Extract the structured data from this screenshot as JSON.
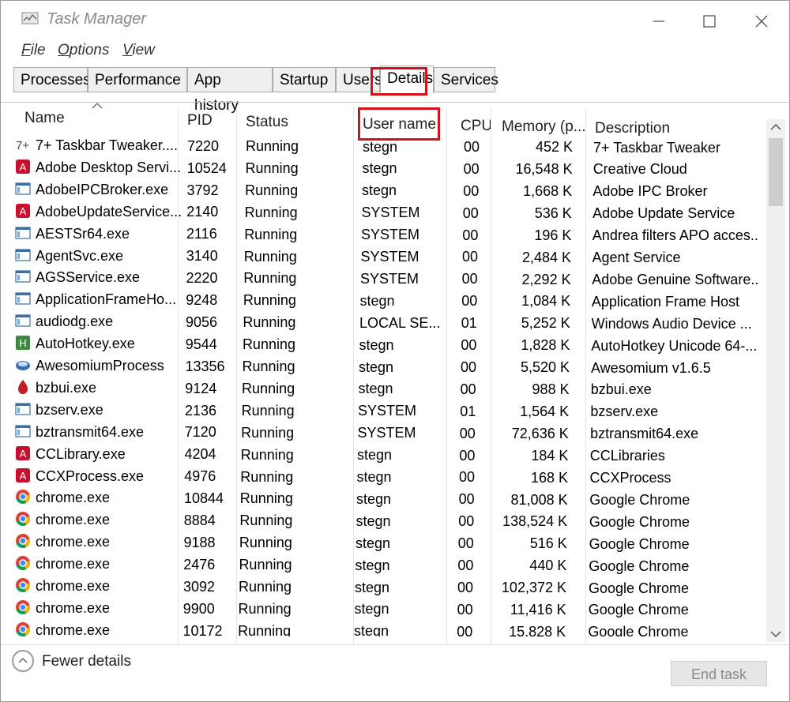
{
  "window": {
    "title": "Task Manager"
  },
  "menu": [
    {
      "label": "File",
      "underline": "F",
      "rest": "ile"
    },
    {
      "label": "Options",
      "underline": "O",
      "rest": "ptions"
    },
    {
      "label": "View",
      "underline": "V",
      "rest": "iew"
    }
  ],
  "tabs": [
    {
      "label": "Processes"
    },
    {
      "label": "Performance"
    },
    {
      "label": "App history"
    },
    {
      "label": "Startup"
    },
    {
      "label": "Users"
    },
    {
      "label": "Details",
      "active": true
    },
    {
      "label": "Services"
    }
  ],
  "columns": {
    "name": "Name",
    "pid": "PID",
    "status": "Status",
    "user": "User name",
    "cpu": "CPU",
    "memory": "Memory (p...",
    "description": "Description"
  },
  "rows": [
    {
      "icon": "taskbar-tweaker-icon",
      "name": "7+ Taskbar Tweaker....",
      "pid": "7220",
      "status": "Running",
      "user": "stegn",
      "cpu": "00",
      "memory": "452 K",
      "description": "7+ Taskbar Tweaker"
    },
    {
      "icon": "adobe-icon",
      "name": "Adobe Desktop Servi...",
      "pid": "10524",
      "status": "Running",
      "user": "stegn",
      "cpu": "00",
      "memory": "16,548 K",
      "description": "Creative Cloud"
    },
    {
      "icon": "app-window-icon",
      "name": "AdobeIPCBroker.exe",
      "pid": "3792",
      "status": "Running",
      "user": "stegn",
      "cpu": "00",
      "memory": "1,668 K",
      "description": "Adobe IPC Broker"
    },
    {
      "icon": "adobe-icon",
      "name": "AdobeUpdateService...",
      "pid": "2140",
      "status": "Running",
      "user": "SYSTEM",
      "cpu": "00",
      "memory": "536 K",
      "description": "Adobe Update Service"
    },
    {
      "icon": "app-window-icon",
      "name": "AESTSr64.exe",
      "pid": "2116",
      "status": "Running",
      "user": "SYSTEM",
      "cpu": "00",
      "memory": "196 K",
      "description": "Andrea filters APO acces..."
    },
    {
      "icon": "app-window-icon",
      "name": "AgentSvc.exe",
      "pid": "3140",
      "status": "Running",
      "user": "SYSTEM",
      "cpu": "00",
      "memory": "2,484 K",
      "description": "Agent Service"
    },
    {
      "icon": "app-window-icon",
      "name": "AGSService.exe",
      "pid": "2220",
      "status": "Running",
      "user": "SYSTEM",
      "cpu": "00",
      "memory": "2,292 K",
      "description": "Adobe Genuine Software..."
    },
    {
      "icon": "app-window-icon",
      "name": "ApplicationFrameHo...",
      "pid": "9248",
      "status": "Running",
      "user": "stegn",
      "cpu": "00",
      "memory": "1,084 K",
      "description": "Application Frame Host"
    },
    {
      "icon": "app-window-icon",
      "name": "audiodg.exe",
      "pid": "9056",
      "status": "Running",
      "user": "LOCAL SE...",
      "cpu": "01",
      "memory": "5,252 K",
      "description": "Windows Audio Device ..."
    },
    {
      "icon": "autohotkey-icon",
      "name": "AutoHotkey.exe",
      "pid": "9544",
      "status": "Running",
      "user": "stegn",
      "cpu": "00",
      "memory": "1,828 K",
      "description": "AutoHotkey Unicode 64-..."
    },
    {
      "icon": "awesomium-icon",
      "name": "AwesomiumProcess",
      "pid": "13356",
      "status": "Running",
      "user": "stegn",
      "cpu": "00",
      "memory": "5,520 K",
      "description": "Awesomium v1.6.5"
    },
    {
      "icon": "bzbui-icon",
      "name": "bzbui.exe",
      "pid": "9124",
      "status": "Running",
      "user": "stegn",
      "cpu": "00",
      "memory": "988 K",
      "description": "bzbui.exe"
    },
    {
      "icon": "app-window-icon",
      "name": "bzserv.exe",
      "pid": "2136",
      "status": "Running",
      "user": "SYSTEM",
      "cpu": "01",
      "memory": "1,564 K",
      "description": "bzserv.exe"
    },
    {
      "icon": "app-window-icon",
      "name": "bztransmit64.exe",
      "pid": "7120",
      "status": "Running",
      "user": "SYSTEM",
      "cpu": "00",
      "memory": "72,636 K",
      "description": "bztransmit64.exe"
    },
    {
      "icon": "adobe-icon",
      "name": "CCLibrary.exe",
      "pid": "4204",
      "status": "Running",
      "user": "stegn",
      "cpu": "00",
      "memory": "184 K",
      "description": "CCLibraries"
    },
    {
      "icon": "adobe-icon",
      "name": "CCXProcess.exe",
      "pid": "4976",
      "status": "Running",
      "user": "stegn",
      "cpu": "00",
      "memory": "168 K",
      "description": "CCXProcess"
    },
    {
      "icon": "chrome-icon",
      "name": "chrome.exe",
      "pid": "10844",
      "status": "Running",
      "user": "stegn",
      "cpu": "00",
      "memory": "81,008 K",
      "description": "Google Chrome"
    },
    {
      "icon": "chrome-icon",
      "name": "chrome.exe",
      "pid": "8884",
      "status": "Running",
      "user": "stegn",
      "cpu": "00",
      "memory": "138,524 K",
      "description": "Google Chrome"
    },
    {
      "icon": "chrome-icon",
      "name": "chrome.exe",
      "pid": "9188",
      "status": "Running",
      "user": "stegn",
      "cpu": "00",
      "memory": "516 K",
      "description": "Google Chrome"
    },
    {
      "icon": "chrome-icon",
      "name": "chrome.exe",
      "pid": "2476",
      "status": "Running",
      "user": "stegn",
      "cpu": "00",
      "memory": "440 K",
      "description": "Google Chrome"
    },
    {
      "icon": "chrome-icon",
      "name": "chrome.exe",
      "pid": "3092",
      "status": "Running",
      "user": "stegn",
      "cpu": "00",
      "memory": "102,372 K",
      "description": "Google Chrome"
    },
    {
      "icon": "chrome-icon",
      "name": "chrome.exe",
      "pid": "9900",
      "status": "Running",
      "user": "stegn",
      "cpu": "00",
      "memory": "11,416 K",
      "description": "Google Chrome"
    },
    {
      "icon": "chrome-icon",
      "name": "chrome.exe",
      "pid": "10172",
      "status": "Running",
      "user": "stegn",
      "cpu": "00",
      "memory": "15,828 K",
      "description": "Google Chrome"
    }
  ],
  "footer": {
    "fewer_details": "Fewer details",
    "end_task": "End task"
  },
  "colors": {
    "highlight": "#d4101a",
    "adobe": "#c8102e",
    "chrome_red": "#db4437",
    "chrome_yellow": "#f4b400",
    "chrome_green": "#0f9d58",
    "chrome_blue": "#4285f4"
  }
}
